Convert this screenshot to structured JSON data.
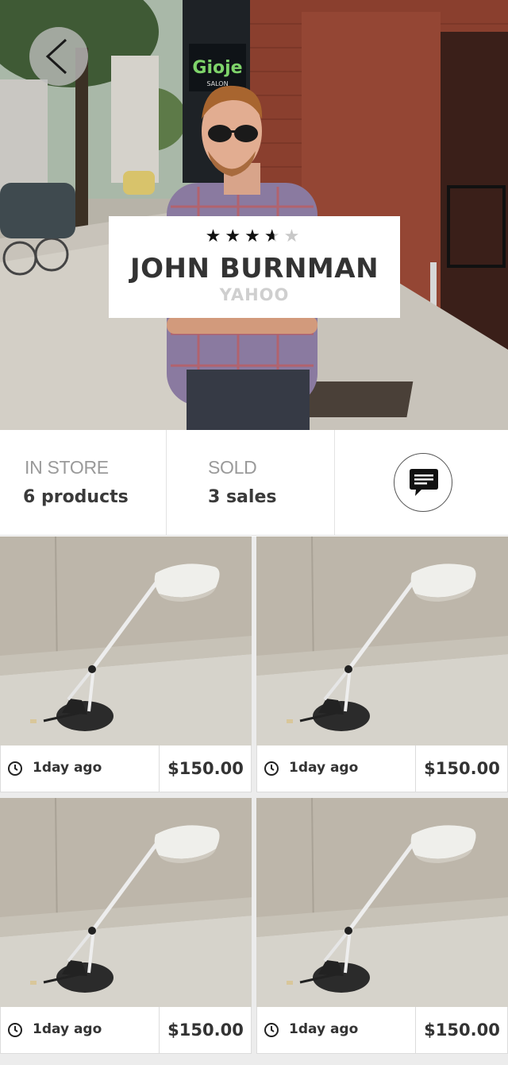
{
  "profile": {
    "name": "JOHN BURNMAN",
    "company": "YAHOO",
    "rating": 3.5,
    "rating_max": 5,
    "stars": [
      "★",
      "★",
      "★",
      "★",
      "★"
    ]
  },
  "stats": {
    "in_store_label": "IN STORE",
    "in_store_value": "6 products",
    "sold_label": "SOLD",
    "sold_value": "3 sales"
  },
  "icons": {
    "back": "chevron-left-icon",
    "chat": "chat-bubble-icon",
    "clock": "clock-icon"
  },
  "products": [
    {
      "time": "1day ago",
      "price": "$150.00"
    },
    {
      "time": "1day ago",
      "price": "$150.00"
    },
    {
      "time": "1day ago",
      "price": "$150.00"
    },
    {
      "time": "1day ago",
      "price": "$150.00"
    }
  ],
  "colors": {
    "text_dark": "#333333",
    "text_muted": "#9a9a9a",
    "company_gray": "#cfcfcf",
    "star_filled": "#111111",
    "star_empty": "#c8c8c8"
  }
}
